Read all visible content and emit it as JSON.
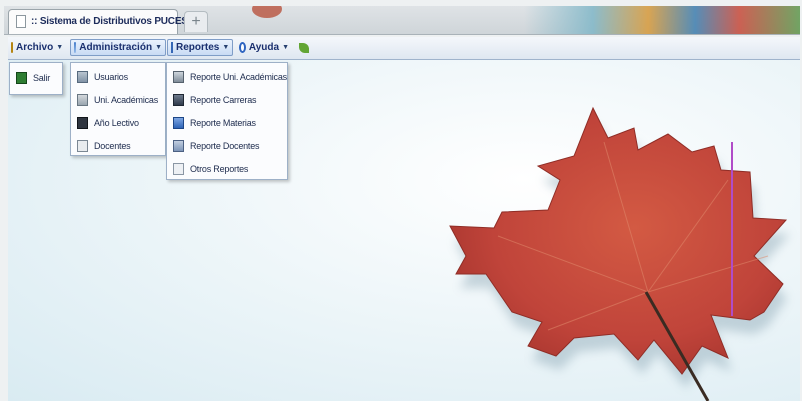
{
  "tab": {
    "title": ":: Sistema de Distributivos PUCESA ::"
  },
  "menubar": {
    "archivo": "Archivo",
    "administracion": "Administración",
    "reportes": "Reportes",
    "ayuda": "Ayuda"
  },
  "menus": {
    "archivo": [
      "Salir"
    ],
    "administracion": [
      "Usuarios",
      "Uni. Académicas",
      "Año Lectivo",
      "Docentes"
    ],
    "reportes": [
      "Reporte Uni. Académicas",
      "Reporte Carreras",
      "Reporte Materias",
      "Reporte Docentes",
      "Otros Reportes"
    ]
  },
  "icons": {
    "archivo": "folder-icon",
    "administracion": "tools-icon",
    "reportes": "report-icon",
    "ayuda": "help-icon",
    "extra": "leaf-icon"
  },
  "colors": {
    "menu_text": "#1a2f6e",
    "leaf": "#c8473a",
    "accent_line": "#b04cc8"
  }
}
